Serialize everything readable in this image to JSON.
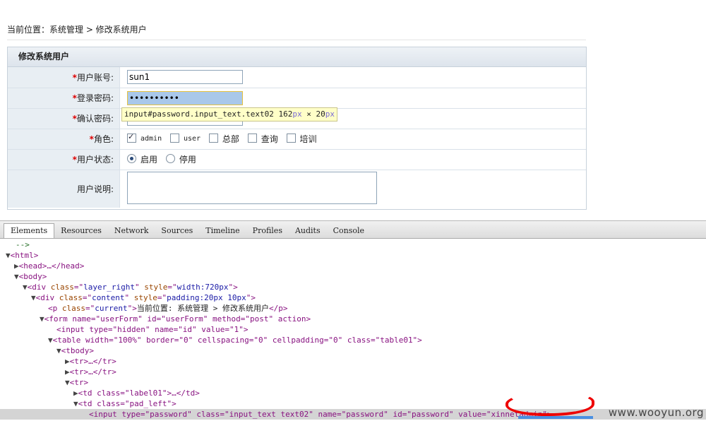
{
  "breadcrumb": "当前位置：系统管理 > 修改系统用户",
  "panel": {
    "title": "修改系统用户",
    "fields": {
      "account": {
        "label": "用户账号:",
        "required": "*",
        "value": "sun1"
      },
      "password": {
        "label": "登录密码:",
        "required": "*",
        "value": "••••••••••"
      },
      "confirm": {
        "label": "确认密码:",
        "required": "*",
        "value": ""
      },
      "role": {
        "label": "角色:",
        "required": "*",
        "options": [
          {
            "label": "admin",
            "checked": true
          },
          {
            "label": "user",
            "checked": false
          },
          {
            "label": "总部",
            "checked": false
          },
          {
            "label": "查询",
            "checked": false
          },
          {
            "label": "培训",
            "checked": false
          }
        ]
      },
      "status": {
        "label": "用户状态:",
        "required": "*",
        "options": [
          {
            "label": "启用",
            "checked": true
          },
          {
            "label": "停用",
            "checked": false
          }
        ]
      },
      "desc": {
        "label": "用户说明:",
        "value": ""
      }
    }
  },
  "tooltip": {
    "selector": "input#password.input_text.text02",
    "w": "162",
    "x": " × ",
    "h": "20",
    "unit": "px"
  },
  "devtools": {
    "tabs": [
      "Elements",
      "Resources",
      "Network",
      "Sources",
      "Timeline",
      "Profiles",
      "Audits",
      "Console"
    ],
    "active_tab": "Elements"
  },
  "dom": {
    "l0": "-->",
    "l1": "<html>",
    "l2": "<head>…</head>",
    "l3": "<body>",
    "l4a": "<div ",
    "l4b": "class",
    "l4c": "=\"",
    "l4d": "layer_right",
    "l4e": "\" ",
    "l4f": "style",
    "l4g": "=\"",
    "l4h": "width:720px",
    "l4i": "\">",
    "l5a": "<div ",
    "l5b": "class",
    "l5c": "=\"",
    "l5d": "content",
    "l5e": "\" ",
    "l5f": "style",
    "l5g": "=\"",
    "l5h": "padding:20px 10px",
    "l5i": "\">",
    "l6a": "<p ",
    "l6b": "class",
    "l6c": "=\"",
    "l6d": "current",
    "l6e": "\">",
    "l6f": "当前位置: 系统管理 > 修改系统用户",
    "l6g": "</p>",
    "l7": "<form name=\"userForm\" id=\"userForm\" method=\"post\" action>",
    "l8": "<input type=\"hidden\" name=\"id\" value=\"1\">",
    "l9": "<table width=\"100%\" border=\"0\" cellspacing=\"0\" cellpadding=\"0\" class=\"table01\">",
    "l10": "<tbody>",
    "l11": "<tr>…</tr>",
    "l12": "<tr>…</tr>",
    "l13": "<tr>",
    "l14": "<td class=\"label01\">…</td>",
    "l15": "<td class=\"pad_left\">",
    "l16": "<input type=\"password\" class=\"input_text text02\" name=\"password\" id=\"password\" value=\"xinnetadmin\">"
  },
  "watermark": "www.wooyun.org"
}
